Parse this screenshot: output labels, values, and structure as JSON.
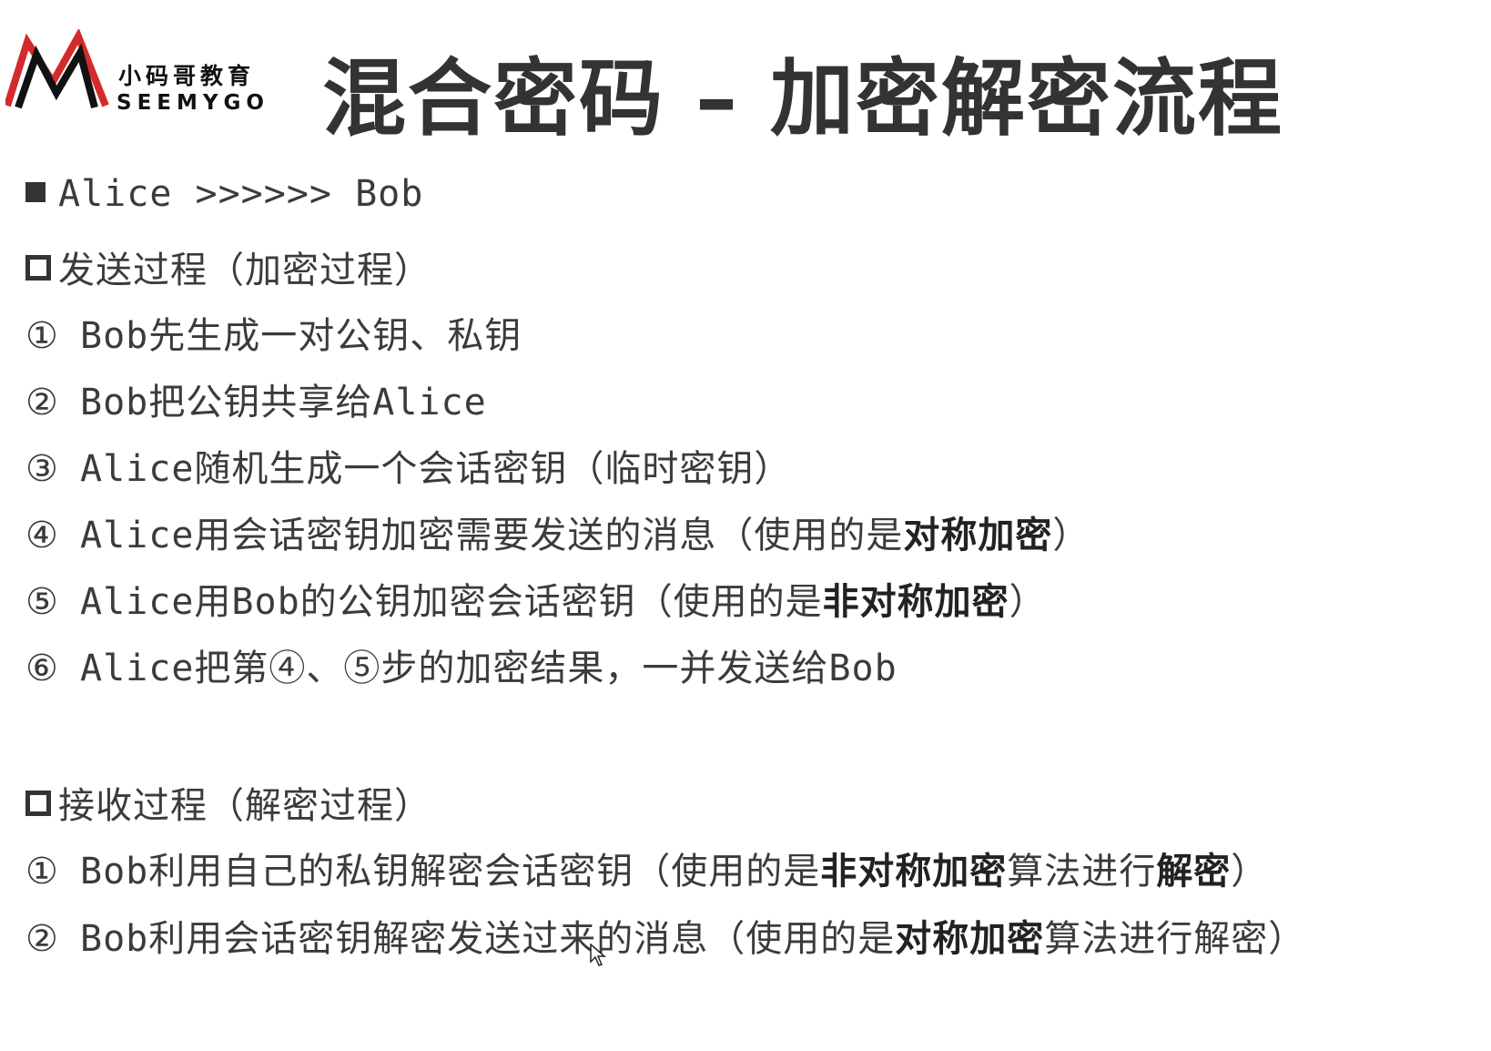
{
  "logo": {
    "cn": "小码哥教育",
    "en": "SEEMYGO"
  },
  "title": "混合密码  –  加密解密流程",
  "heading": "Alice >>>>>> Bob",
  "send": {
    "heading": "发送过程（加密过程）",
    "steps": [
      {
        "num": "①",
        "parts": [
          "Bob先生成一对公钥、私钥"
        ]
      },
      {
        "num": "②",
        "parts": [
          "Bob把公钥共享给Alice"
        ]
      },
      {
        "num": "③",
        "parts": [
          "Alice随机生成一个会话密钥（临时密钥）"
        ]
      },
      {
        "num": "④",
        "parts": [
          "Alice用会话密钥加密需要发送的消息（使用的是",
          "对称加密",
          "）"
        ]
      },
      {
        "num": "⑤",
        "parts": [
          "Alice用Bob的公钥加密会话密钥（使用的是",
          "非对称加密",
          "）"
        ]
      },
      {
        "num": "⑥",
        "parts": [
          "Alice把第④、⑤步的加密结果，一并发送给Bob"
        ]
      }
    ]
  },
  "receive": {
    "heading": "接收过程（解密过程）",
    "steps": [
      {
        "num": "①",
        "parts": [
          "Bob利用自己的私钥解密会话密钥（使用的是",
          "非对称加密",
          "算法进行",
          "解密",
          "）"
        ]
      },
      {
        "num": "②",
        "parts": [
          "Bob利用会话密钥解密发送过来的消息（使用的是",
          "对称加密",
          "算法进行解密）"
        ]
      }
    ]
  }
}
